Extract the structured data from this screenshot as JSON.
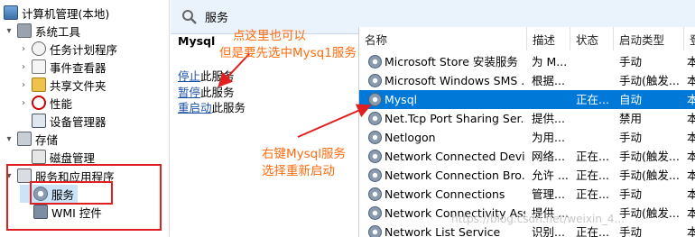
{
  "tree": {
    "root_label": "计算机管理(本地)",
    "items": [
      {
        "label": "系统工具",
        "chev": "▾",
        "icon": "tools-icon"
      },
      {
        "label": "任务计划程序",
        "chev": "›",
        "icon": "clock-icon"
      },
      {
        "label": "事件查看器",
        "chev": "›",
        "icon": "event-viewer-icon"
      },
      {
        "label": "共享文件夹",
        "chev": "›",
        "icon": "shared-folder-icon"
      },
      {
        "label": "性能",
        "chev": "›",
        "icon": "performance-icon"
      },
      {
        "label": "设备管理器",
        "chev": "",
        "icon": "device-manager-icon"
      },
      {
        "label": "存储",
        "chev": "▾",
        "icon": "storage-icon"
      },
      {
        "label": "磁盘管理",
        "chev": "",
        "icon": "disk-icon"
      },
      {
        "label": "服务和应用程序",
        "chev": "▾",
        "icon": "services-apps-icon"
      },
      {
        "label": "服务",
        "chev": "",
        "icon": "services-gear-icon"
      },
      {
        "label": "WMI 控件",
        "chev": "",
        "icon": "wmi-icon"
      }
    ]
  },
  "header": {
    "title": "服务"
  },
  "description": {
    "service_name": "Mysql",
    "stop_link": "停止",
    "stop_suffix": "此服务",
    "pause_link": "暂停",
    "pause_suffix": "此服务",
    "restart_link": "重启动",
    "restart_suffix": "此服务"
  },
  "list": {
    "columns": [
      "名称",
      "描述",
      "状态",
      "启动类型",
      "登"
    ],
    "rows": [
      {
        "name": "Microsoft Store 安装服务",
        "desc": "为 M...",
        "status": "",
        "startup": "手动",
        "logon": "本"
      },
      {
        "name": "Microsoft Windows SMS ...",
        "desc": "根据...",
        "status": "",
        "startup": "手动(触发...",
        "logon": "本"
      },
      {
        "name": "Mysql",
        "desc": "",
        "status": "正在...",
        "startup": "自动",
        "logon": "本"
      },
      {
        "name": "Net.Tcp Port Sharing Ser...",
        "desc": "提供...",
        "status": "",
        "startup": "禁用",
        "logon": "本"
      },
      {
        "name": "Netlogon",
        "desc": "为用...",
        "status": "",
        "startup": "手动",
        "logon": "本"
      },
      {
        "name": "Network Connected Devi...",
        "desc": "网络...",
        "status": "正在...",
        "startup": "手动(触发...",
        "logon": "本"
      },
      {
        "name": "Network Connection Bro...",
        "desc": "允许 ...",
        "status": "正在...",
        "startup": "手动(触发...",
        "logon": "本"
      },
      {
        "name": "Network Connections",
        "desc": "管理...",
        "status": "正在...",
        "startup": "手动",
        "logon": "本"
      },
      {
        "name": "Network Connectivity Ass...",
        "desc": "提供 ...",
        "status": "",
        "startup": "手动(触发...",
        "logon": "本"
      },
      {
        "name": "Network List Service",
        "desc": "识别...",
        "status": "正在...",
        "startup": "手动",
        "logon": "本"
      }
    ]
  },
  "annotations": {
    "top_line1": "点这里也可以",
    "top_line2": "但是要先选中Mysq1服务",
    "mid_line1": "右键Mysql服务",
    "mid_line2": "选择重新启动"
  },
  "watermark": "https://blog.csdn.net/weixin_4...",
  "colors": {
    "selection": "#0078d7",
    "annotation": "#ff6b10",
    "highlight_box": "#e02020",
    "link": "#1a4fa8",
    "header_bg": "#eaf2fb"
  }
}
